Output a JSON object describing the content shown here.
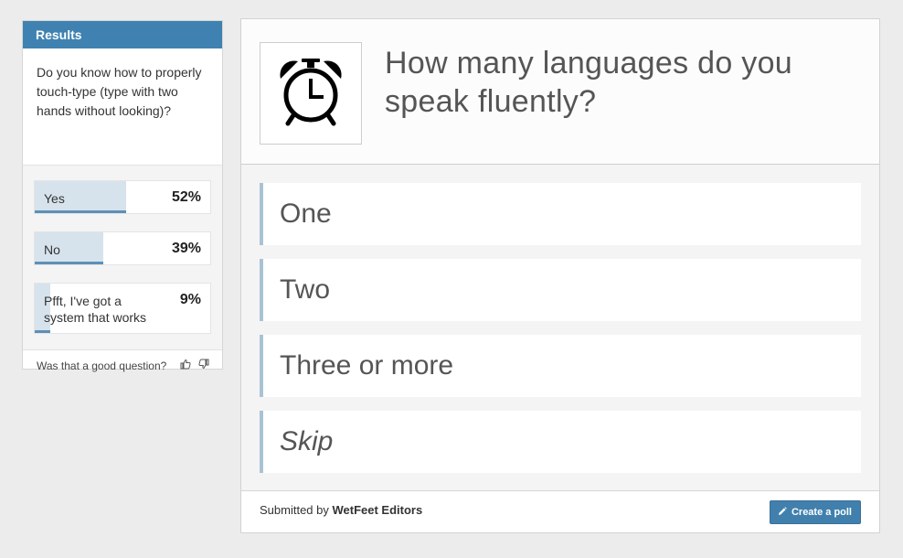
{
  "results_panel": {
    "header": "Results",
    "question": "Do you know how to properly touch-type (type with two hands without looking)?",
    "answers": [
      {
        "label": "Yes",
        "percent_label": "52%",
        "fraction": 0.52
      },
      {
        "label": "No",
        "percent_label": "39%",
        "fraction": 0.39
      },
      {
        "label": "Pfft, I've got a system that works",
        "percent_label": "9%",
        "fraction": 0.09
      }
    ],
    "feedback_text": "Was that a good question?",
    "thumbs_up_icon": "thumbs-up-icon",
    "thumbs_down_icon": "thumbs-down-icon"
  },
  "poll": {
    "image_icon": "alarm-clock-icon",
    "question": "How many languages do you speak fluently?",
    "options": [
      "One",
      "Two",
      "Three or more",
      "Skip"
    ],
    "submitted_prefix": "Submitted by",
    "submitted_by": "WetFeet Editors",
    "create_button": "Create a poll",
    "create_icon": "pencil-icon"
  },
  "colors": {
    "accent": "#3f82b1",
    "bar_fill": "#d7e3ec",
    "bar_line": "#5d90b8",
    "option_border": "#a9c2d4"
  }
}
